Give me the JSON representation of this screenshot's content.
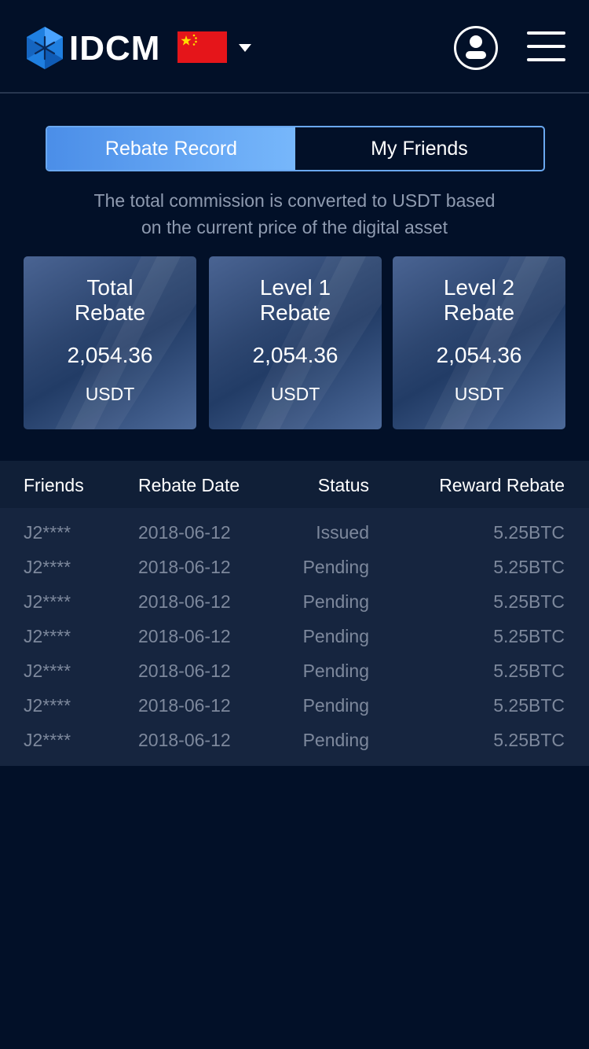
{
  "header": {
    "brand": "IDCM",
    "language_flag": "china-flag-icon",
    "dropdown_icon": "caret-down-icon",
    "user_icon": "user-icon",
    "menu_icon": "hamburger-menu-icon"
  },
  "tabs": [
    {
      "label": "Rebate Record",
      "active": true
    },
    {
      "label": "My Friends",
      "active": false
    }
  ],
  "note": {
    "line1": "The total commission is converted to USDT based",
    "line2": "on the current price of the digital asset"
  },
  "cards": [
    {
      "title_line1": "Total",
      "title_line2": "Rebate",
      "value": "2,054.36",
      "unit": "USDT"
    },
    {
      "title_line1": "Level 1",
      "title_line2": "Rebate",
      "value": "2,054.36",
      "unit": "USDT"
    },
    {
      "title_line1": "Level 2",
      "title_line2": "Rebate",
      "value": "2,054.36",
      "unit": "USDT"
    }
  ],
  "table": {
    "headers": [
      "Friends",
      "Rebate Date",
      "Status",
      "Reward Rebate"
    ],
    "rows": [
      {
        "friend": "J2****",
        "date": "2018-06-12",
        "status": "Issued",
        "reward": "5.25BTC"
      },
      {
        "friend": "J2****",
        "date": "2018-06-12",
        "status": "Pending",
        "reward": "5.25BTC"
      },
      {
        "friend": "J2****",
        "date": "2018-06-12",
        "status": "Pending",
        "reward": "5.25BTC"
      },
      {
        "friend": "J2****",
        "date": "2018-06-12",
        "status": "Pending",
        "reward": "5.25BTC"
      },
      {
        "friend": "J2****",
        "date": "2018-06-12",
        "status": "Pending",
        "reward": "5.25BTC"
      },
      {
        "friend": "J2****",
        "date": "2018-06-12",
        "status": "Pending",
        "reward": "5.25BTC"
      },
      {
        "friend": "J2****",
        "date": "2018-06-12",
        "status": "Pending",
        "reward": "5.25BTC"
      }
    ]
  },
  "colors": {
    "background": "#021028",
    "accent": "#4b8ee8",
    "card": "#2d4670",
    "table_head": "#101f37",
    "table_body": "#16253f"
  }
}
